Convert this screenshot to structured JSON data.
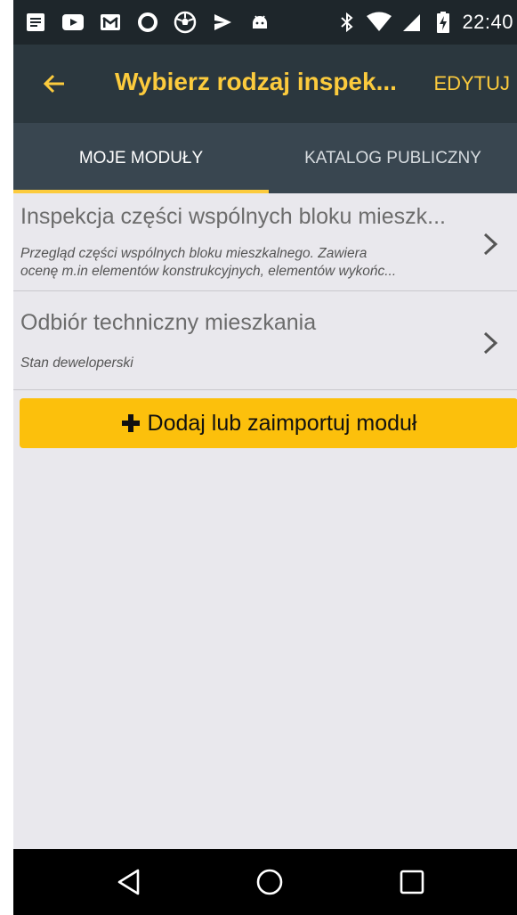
{
  "statusbar": {
    "time": "22:40",
    "left_icons": [
      "notes-icon",
      "youtube-icon",
      "gmail-icon",
      "circle-app-icon",
      "soccer-ball-icon",
      "send-icon",
      "android-icon"
    ],
    "right_icons": [
      "bluetooth-icon",
      "wifi-icon",
      "signal-icon",
      "battery-charging-icon"
    ]
  },
  "appbar": {
    "title": "Wybierz rodzaj inspek...",
    "edit_label": "EDYTUJ",
    "accent_color": "#fccb3d"
  },
  "tabs": [
    {
      "label": "MOJE MODUŁY",
      "active": true
    },
    {
      "label": "KATALOG PUBLICZNY",
      "active": false
    }
  ],
  "modules": [
    {
      "title": "Inspekcja części wspólnych bloku mieszk...",
      "desc_lines": [
        "Przegląd części wspólnych bloku mieszkalnego. Zawiera",
        "ocenę m.in elementów konstrukcyjnych, elementów wykońc..."
      ]
    },
    {
      "title": "Odbiór techniczny mieszkania",
      "desc_lines": [
        "Stan deweloperski"
      ]
    }
  ],
  "add_button": {
    "label": "Dodaj lub zaimportuj moduł",
    "icon": "plus-icon",
    "color": "#fcc00c"
  },
  "navbar": {
    "icons": [
      "back-triangle-icon",
      "home-circle-icon",
      "recents-square-icon"
    ]
  }
}
